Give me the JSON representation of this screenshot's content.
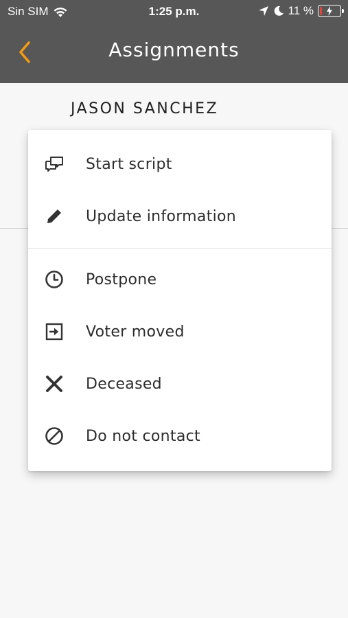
{
  "status_bar": {
    "carrier": "Sin SIM",
    "time": "1:25 p.m.",
    "battery_percent": "11 %",
    "battery_level": 0.11
  },
  "nav": {
    "title": "Assignments",
    "accent_color": "#f39c12"
  },
  "voter": {
    "name": "JASON SANCHEZ"
  },
  "menu": {
    "items": [
      {
        "label": "Start script",
        "icon": "chat-bubbles-icon"
      },
      {
        "label": "Update information",
        "icon": "pencil-icon"
      },
      {
        "label": "Postpone",
        "icon": "clock-icon"
      },
      {
        "label": "Voter moved",
        "icon": "move-arrow-icon"
      },
      {
        "label": "Deceased",
        "icon": "x-icon"
      },
      {
        "label": "Do not contact",
        "icon": "block-icon"
      }
    ]
  }
}
